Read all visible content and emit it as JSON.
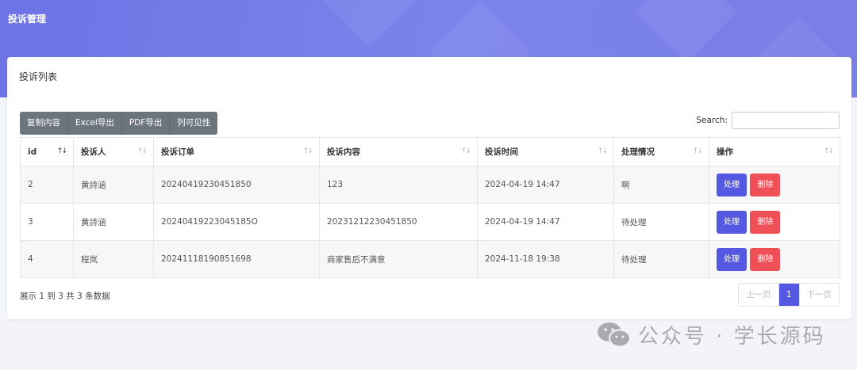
{
  "header": {
    "title": "投诉管理"
  },
  "card": {
    "title": "投诉列表"
  },
  "toolbar": {
    "buttons": [
      "复制内容",
      "Excel导出",
      "PDF导出",
      "列可见性"
    ]
  },
  "search": {
    "label": "Search:",
    "value": ""
  },
  "table": {
    "columns": [
      "id",
      "投诉人",
      "投诉订单",
      "投诉内容",
      "投诉时间",
      "处理情况",
      "操作"
    ],
    "rows": [
      {
        "id": "2",
        "complainant": "黄詩涵",
        "order": "20240419230451850",
        "content": "123",
        "time": "2024-04-19 14:47",
        "status": "啊"
      },
      {
        "id": "3",
        "complainant": "黄詩涵",
        "order": "20240419223045185O",
        "content": "20231212230451850",
        "time": "2024-04-19 14:47",
        "status": "待处理"
      },
      {
        "id": "4",
        "complainant": "程岚",
        "order": "20241118190851698",
        "content": "商家售后不满意",
        "time": "2024-11-18 19:38",
        "status": "待处理"
      }
    ],
    "action_labels": {
      "process": "处理",
      "delete": "删除"
    }
  },
  "footer": {
    "info": "展示 1 到 3 共 3 条数据",
    "pager": {
      "prev": "上一页",
      "current": "1",
      "next": "下一页"
    }
  },
  "watermark": {
    "text": "公众号 · 学长源码"
  },
  "colors": {
    "header_bg": "#7178e8",
    "primary": "#5558e0",
    "danger": "#ef4f57",
    "toolbar": "#6c757d"
  }
}
